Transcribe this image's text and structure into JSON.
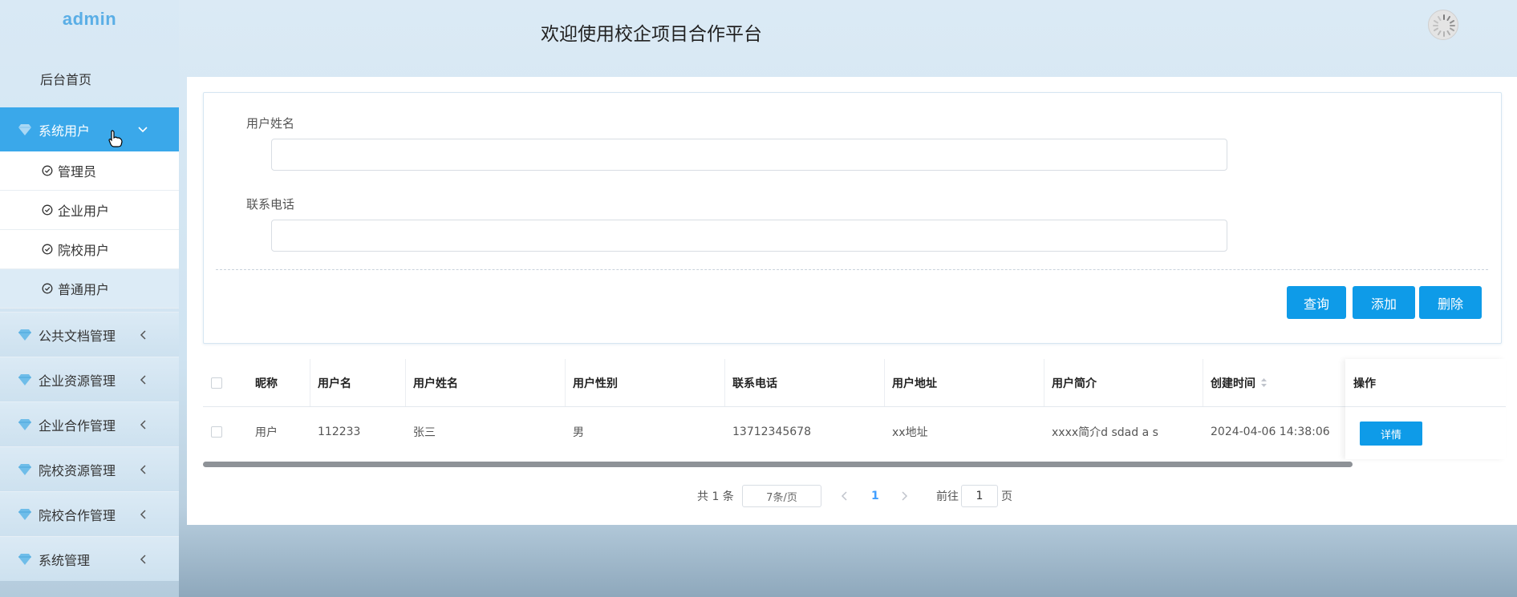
{
  "app": {
    "logo": "admin",
    "title": "欢迎使用校企项目合作平台"
  },
  "sidebar": {
    "home": "后台首页",
    "active_group": "系统用户",
    "sub_items": [
      "管理员",
      "企业用户",
      "院校用户",
      "普通用户"
    ],
    "groups": [
      "公共文档管理",
      "企业资源管理",
      "企业合作管理",
      "院校资源管理",
      "院校合作管理",
      "系统管理"
    ]
  },
  "search": {
    "name_label": "用户姓名",
    "name_value": "",
    "phone_label": "联系电话",
    "phone_value": "",
    "query_button": "查询",
    "add_button": "添加",
    "delete_button": "删除"
  },
  "table": {
    "headers": [
      "昵称",
      "用户名",
      "用户姓名",
      "用户性别",
      "联系电话",
      "用户地址",
      "用户简介",
      "创建时间",
      "操作"
    ],
    "rows": [
      {
        "nickname": "用户",
        "username": "112233",
        "realname": "张三",
        "gender": "男",
        "phone": "13712345678",
        "address": "xx地址",
        "intro": "xxxx简介d sdad a s",
        "created": "2024-04-06 14:38:06",
        "action": "详情"
      }
    ]
  },
  "pagination": {
    "total": "共 1 条",
    "page_size": "7条/页",
    "current_page": "1",
    "goto_label": "前往",
    "goto_value": "1",
    "page_suffix": "页"
  },
  "colors": {
    "accent": "#0e9be8",
    "sidebar_active": "#3aa8ea",
    "logo": "#5aaee6"
  }
}
